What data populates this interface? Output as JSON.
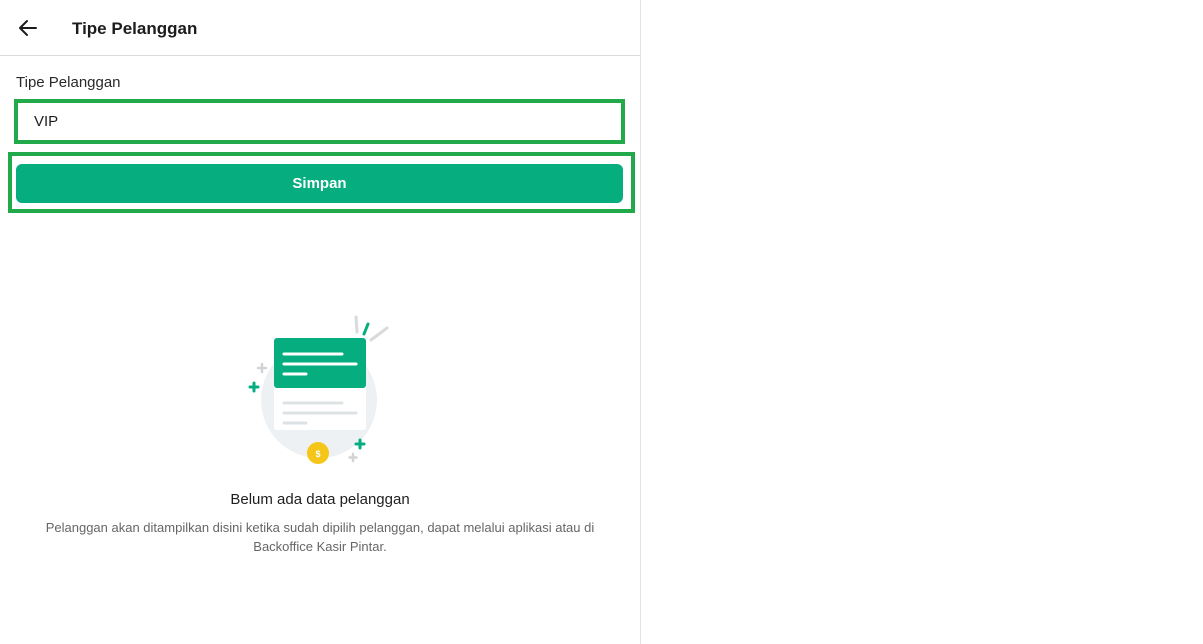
{
  "header": {
    "back_icon": "arrow-left-icon",
    "title": "Tipe Pelanggan"
  },
  "form": {
    "label": "Tipe Pelanggan",
    "input_value": "VIP",
    "save_label": "Simpan"
  },
  "empty_state": {
    "illustration_icon": "document-list-icon",
    "title": "Belum ada data pelanggan",
    "description": "Pelanggan akan ditampilkan disini ketika sudah dipilih pelanggan, dapat melalui aplikasi atau di Backoffice Kasir Pintar."
  },
  "colors": {
    "accent": "#05ad7f",
    "highlight": "#22a94a",
    "coin": "#f5c518"
  }
}
